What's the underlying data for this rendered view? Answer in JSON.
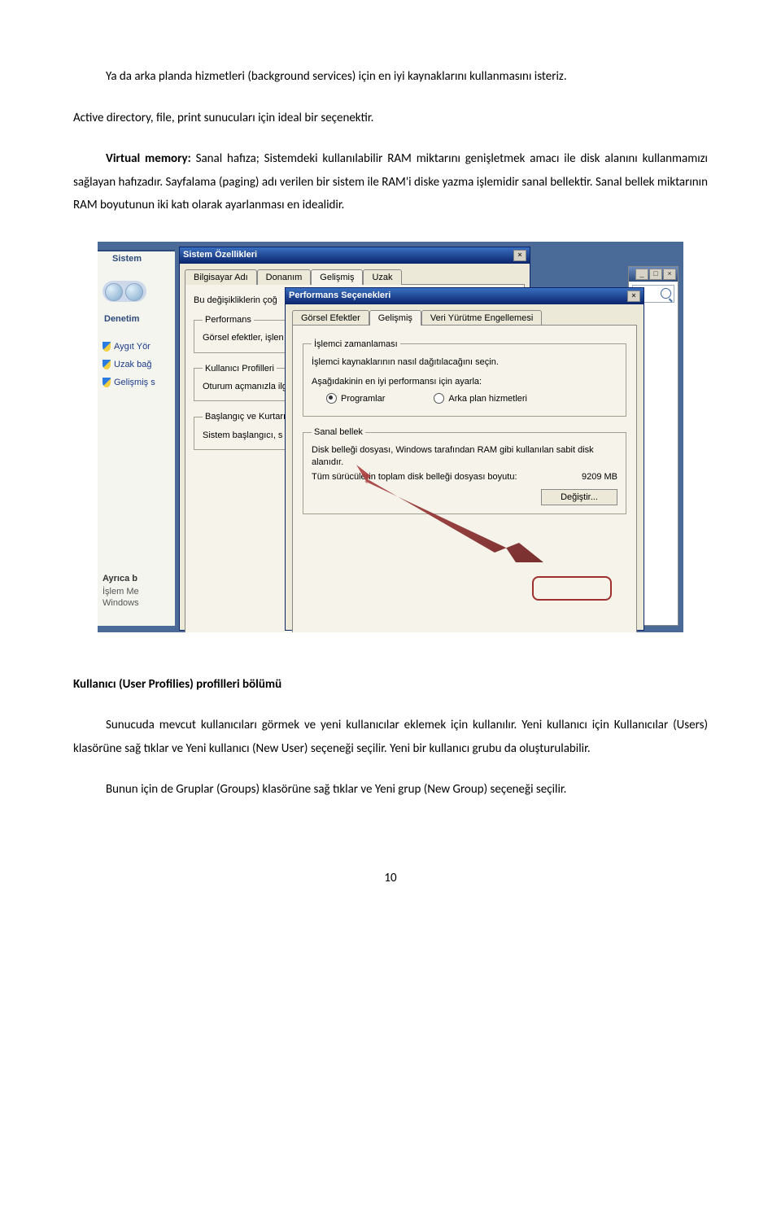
{
  "document": {
    "p1": "Ya da arka planda hizmetleri (background services) için en iyi kaynaklarını kullanmasını isteriz.",
    "p2": "Active directory, file, print sunucuları için ideal bir seçenektir.",
    "p3_bold": "Virtual memory:",
    "p3_rest": " Sanal hafıza; Sistemdeki kullanılabilir RAM miktarını genişletmek amacı ile disk alanını kullanmamızı sağlayan hafızadır. Sayfalama (paging) adı verilen bir sistem ile RAM'i diske yazma işlemidir sanal bellektir. Sanal bellek miktarının RAM boyutunun iki katı olarak ayarlanması en idealidir.",
    "h2": "Kullanıcı (User Profilies) profilleri bölümü",
    "p4": "Sunucuda mevcut kullanıcıları görmek ve yeni kullanıcılar eklemek için kullanılır. Yeni kullanıcı için Kullanıcılar (Users) klasörüne sağ tıklar ve Yeni kullanıcı (New User) seçeneği seçilir. Yeni bir kullanıcı grubu da oluşturulabilir.",
    "p5": "Bunun için de Gruplar (Groups) klasörüne sağ tıklar ve Yeni grup (New Group) seçeneği seçilir.",
    "page_number": "10"
  },
  "bg": {
    "sistem": "Sistem",
    "denetim": "Denetim",
    "link1": "Aygıt Yör",
    "link2": "Uzak bağ",
    "link3": "Gelişmiş s",
    "ayrica": "Ayrıca b",
    "islem": "İşlem Me",
    "windows": "Windows"
  },
  "dlg1": {
    "title": "Sistem Özellikleri",
    "tabs": {
      "t1": "Bilgisayar Adı",
      "t2": "Donanım",
      "t3": "Gelişmiş",
      "t4": "Uzak"
    },
    "note": "Bu değişikliklerin çoğ",
    "g1_legend": "Performans",
    "g1_text": "Görsel efektler, işlen",
    "g2_legend": "Kullanıcı Profilleri",
    "g2_text": "Oturum açmanızla ilg",
    "g3_legend": "Başlangıç ve Kurtarı",
    "g3_text": "Sistem başlangıcı, s"
  },
  "dlg2": {
    "title": "Performans Seçenekleri",
    "tabs": {
      "t1": "Görsel Efektler",
      "t2": "Gelişmiş",
      "t3": "Veri Yürütme Engellemesi"
    },
    "grp1_legend": "İşlemci zamanlaması",
    "grp1_text": "İşlemci kaynaklarının nasıl dağıtılacağını seçin.",
    "grp1_prompt": "Aşağıdakinin en iyi performansı için ayarla:",
    "radio1": "Programlar",
    "radio2": "Arka plan hizmetleri",
    "grp2_legend": "Sanal bellek",
    "grp2_text": "Disk belleği dosyası, Windows tarafından RAM gibi kullanılan sabit disk alanıdır.",
    "grp2_row_label": "Tüm sürücülerin toplam disk belleği dosyası boyutu:",
    "grp2_row_value": "9209 MB",
    "change_btn": "Değiştir..."
  }
}
